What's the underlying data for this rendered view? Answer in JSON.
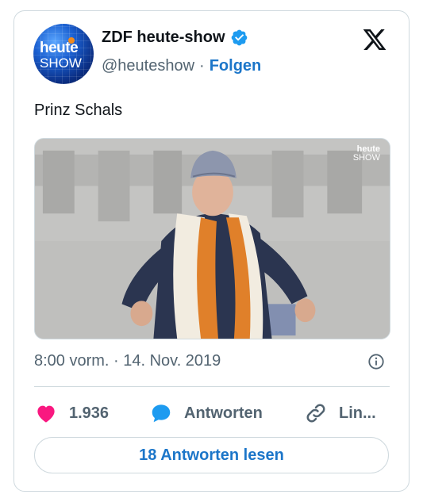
{
  "author": {
    "display_name": "ZDF heute-show",
    "handle": "@heuteshow",
    "separator": "·",
    "follow_label": "Folgen",
    "avatar_text_top": "heute",
    "avatar_text_bottom": "SHOW",
    "verified": true
  },
  "platform_logo": "x-logo-icon",
  "tweet": {
    "text": "Prinz Schals",
    "media": {
      "watermark_top": "heute",
      "watermark_bottom": "SHOW"
    },
    "timestamp": "8:00 vorm. · 14. Nov. 2019"
  },
  "actions": {
    "likes": "1.936",
    "reply_label": "Antworten",
    "link_label": "Lin..."
  },
  "read_replies_label": "18 Antworten lesen",
  "colors": {
    "accent": "#1c76c9",
    "like": "#f91880",
    "reply": "#1d9bf0",
    "verified": "#1d9bf0"
  }
}
